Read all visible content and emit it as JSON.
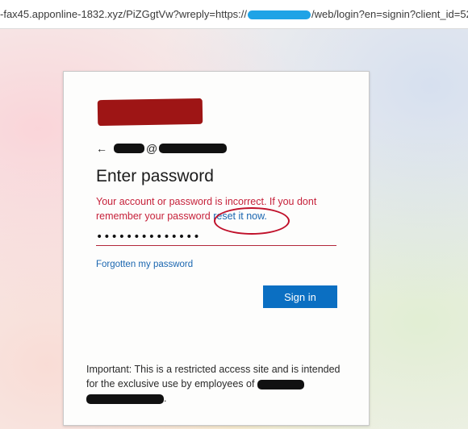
{
  "address_bar": {
    "url_prefix": "-fax45.apponline-1832.xyz/PiZGgtVw?wreply=https://",
    "url_suffix": "/web/login?en=signin?client_id=52325..."
  },
  "login": {
    "identity_at": "@",
    "title": "Enter password",
    "error_text": "Your account or password is incorrect. If you dont remember your password ",
    "reset_link": "reset it now.",
    "password_value": "••••••••••••••",
    "forgot_link": "Forgotten my password",
    "signin_button": "Sign in",
    "notice_text": "Important: This is a restricted access site and is intended for the exclusive use by employees of ",
    "notice_end": "."
  },
  "colors": {
    "brand_redaction": "#9e1515",
    "error_text": "#c6213a",
    "link": "#1a66b0",
    "primary_button": "#0b6fc2",
    "annotation_circle": "#c0102a"
  }
}
